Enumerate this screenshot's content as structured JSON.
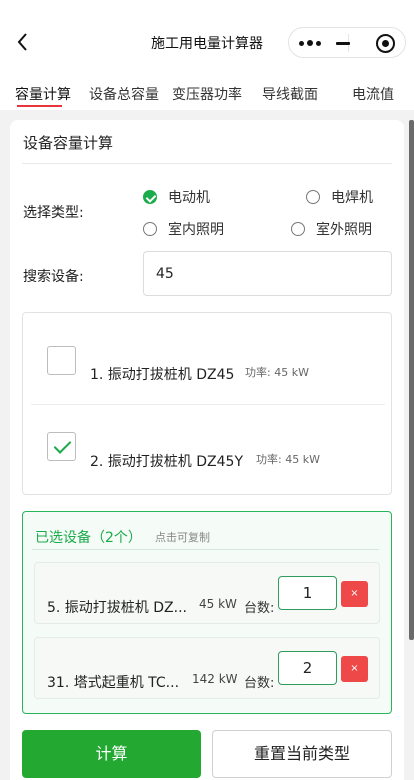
{
  "header": {
    "title": "施工用电量计算器",
    "back_icon": "chevron-left-icon",
    "capsule_icons": [
      "more-dots-icon",
      "minimize-icon",
      "target-icon"
    ]
  },
  "tabs": [
    {
      "label": "容量计算",
      "active": true
    },
    {
      "label": "设备总容量",
      "active": false
    },
    {
      "label": "变压器功率",
      "active": false
    },
    {
      "label": "导线截面",
      "active": false
    },
    {
      "label": "电流值",
      "active": false
    }
  ],
  "card": {
    "title": "设备容量计算",
    "type_label": "选择类型:",
    "types": [
      {
        "label": "电动机",
        "checked": true
      },
      {
        "label": "电焊机",
        "checked": false
      },
      {
        "label": "室内照明",
        "checked": false
      },
      {
        "label": "室外照明",
        "checked": false
      }
    ],
    "search_label": "搜索设备:",
    "search_value": "45",
    "results": [
      {
        "name": "1. 振动打拔桩机 DZ45",
        "power": "功率: 45 kW",
        "checked": false
      },
      {
        "name": "2. 振动打拔桩机 DZ45Y",
        "power": "功率: 45 kW",
        "checked": true
      }
    ],
    "selected": {
      "title": "已选设备（2个）",
      "hint": "点击可复制",
      "qty_label": "台数:",
      "delete_label": "×",
      "items": [
        {
          "name": "5. 振动打拔桩机 DZ...",
          "kw": "45 kW",
          "qty": "1"
        },
        {
          "name": "31. 塔式起重机 TC...",
          "kw": "142 kW",
          "qty": "2"
        }
      ]
    }
  },
  "buttons": {
    "calculate": "计算",
    "reset": "重置当前类型"
  },
  "colors": {
    "accent_green": "#1aab4a",
    "tab_underline_red": "#e8353b",
    "delete_red": "#ef4848"
  }
}
